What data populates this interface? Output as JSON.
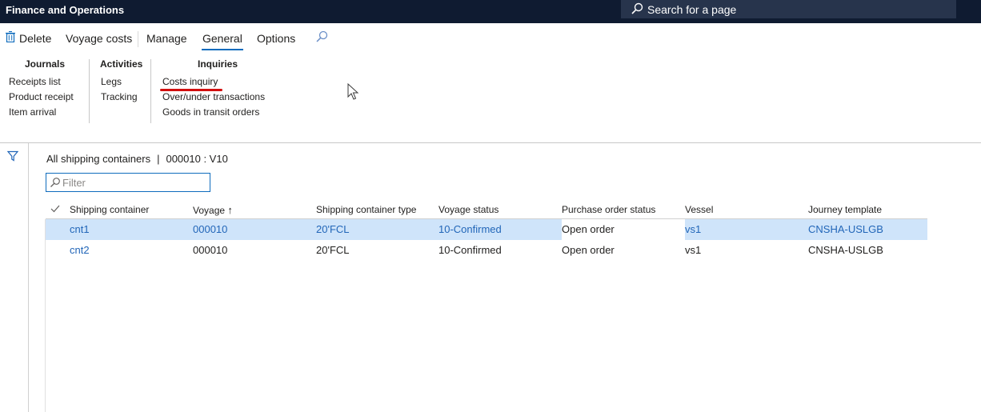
{
  "app": {
    "title": "Finance and Operations"
  },
  "search": {
    "label": "Search for a page"
  },
  "actionbar": {
    "delete": "Delete",
    "voyage_costs": "Voyage costs",
    "manage": "Manage",
    "general": "General",
    "options": "Options"
  },
  "ribbon": {
    "journals": {
      "title": "Journals",
      "items": [
        "Receipts list",
        "Product receipt",
        "Item arrival"
      ]
    },
    "activities": {
      "title": "Activities",
      "items": [
        "Legs",
        "Tracking"
      ]
    },
    "inquiries": {
      "title": "Inquiries",
      "items": [
        "Costs inquiry",
        "Over/under transactions",
        "Goods in transit orders"
      ]
    }
  },
  "page": {
    "caption_left": "All shipping containers",
    "caption_sep": "|",
    "caption_right": "000010 : V10"
  },
  "filter": {
    "placeholder": "Filter"
  },
  "grid": {
    "columns": [
      "Shipping container",
      "Voyage",
      "Shipping container type",
      "Voyage status",
      "Purchase order status",
      "Vessel",
      "Journey template"
    ],
    "sort_indicator": "↑",
    "rows": [
      [
        "cnt1",
        "000010",
        "20'FCL",
        "10-Confirmed",
        "Open order",
        "vs1",
        "CNSHA-USLGB"
      ],
      [
        "cnt2",
        "000010",
        "20'FCL",
        "10-Confirmed",
        "Open order",
        "vs1",
        "CNSHA-USLGB"
      ]
    ],
    "selected_row": 0
  },
  "colors": {
    "topbar": "#0f1b31",
    "accent": "#0f6cbd",
    "selection": "#cfe4fa",
    "link": "#2266b8",
    "annotation": "#d20f0f"
  }
}
